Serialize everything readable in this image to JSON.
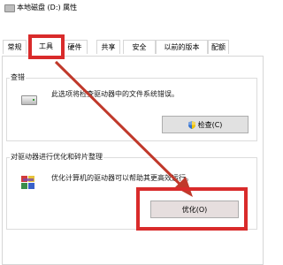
{
  "window": {
    "title": "本地磁盘 (D:) 属性",
    "icon": "drive-icon"
  },
  "tabs": [
    {
      "label": "常规",
      "active": false
    },
    {
      "label": "工具",
      "active": true
    },
    {
      "label": "硬件",
      "active": false
    },
    {
      "label": "共享",
      "active": false
    },
    {
      "label": "安全",
      "active": false
    },
    {
      "label": "以前的版本",
      "active": false
    },
    {
      "label": "配额",
      "active": false
    }
  ],
  "error_check": {
    "title": "查错",
    "description": "此选项将检查驱动器中的文件系统错误。",
    "button_label": "检查(C)",
    "button_icon": "uac-shield-icon"
  },
  "optimize": {
    "title": "对驱动器进行优化和碎片整理",
    "description": "优化计算机的驱动器可以帮助其更高效运行。",
    "button_label": "优化(O)",
    "icon": "defrag-icon"
  },
  "colors": {
    "highlight": "#d92b2b",
    "accent": "#e0d8d8"
  }
}
